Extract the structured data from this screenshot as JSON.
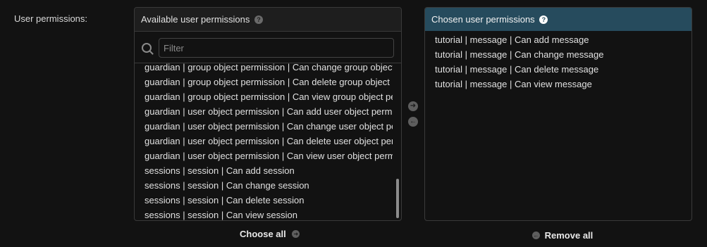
{
  "field": {
    "label": "User permissions:"
  },
  "available": {
    "title": "Available user permissions",
    "filter_placeholder": "Filter",
    "options": [
      "guardian | group object permission | Can change group object permission",
      "guardian | group object permission | Can delete group object permission",
      "guardian | group object permission | Can view group object permission",
      "guardian | user object permission | Can add user object permission",
      "guardian | user object permission | Can change user object permission",
      "guardian | user object permission | Can delete user object permission",
      "guardian | user object permission | Can view user object permission",
      "sessions | session | Can add session",
      "sessions | session | Can change session",
      "sessions | session | Can delete session",
      "sessions | session | Can view session"
    ],
    "choose_all_label": "Choose all"
  },
  "chosen": {
    "title": "Chosen user permissions",
    "options": [
      "tutorial | message | Can add message",
      "tutorial | message | Can change message",
      "tutorial | message | Can delete message",
      "tutorial | message | Can view message"
    ],
    "remove_all_label": "Remove all"
  },
  "icons": {
    "help": "question-circle-icon",
    "search": "search-icon",
    "add": "arrow-right-circle-icon",
    "remove": "arrow-left-circle-icon"
  },
  "colors": {
    "chosen_header": "#264b5d",
    "background": "#121212"
  }
}
